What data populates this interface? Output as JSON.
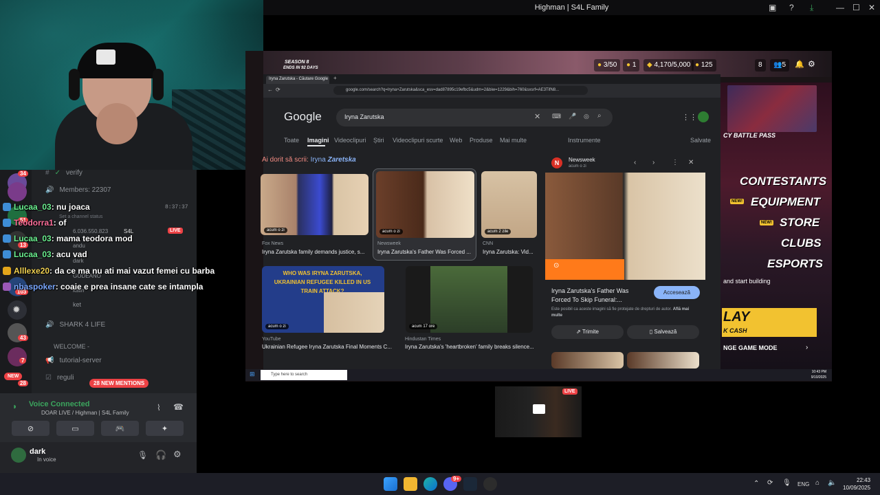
{
  "window": {
    "title": "Highman | S4L Family"
  },
  "discord": {
    "servers": [
      {
        "badge": "34"
      },
      {
        "badge": "51"
      },
      {
        "badge": "13"
      },
      {
        "badge": "103"
      },
      {
        "badge": "43"
      },
      {
        "badge": "7"
      },
      {
        "badge": "NEW"
      },
      {
        "badge": "28"
      }
    ],
    "channels": {
      "verify": "verify",
      "members": "Members: 22307",
      "custom_status": "Set a channel status",
      "count": "6.036.550.823",
      "s4l": "S4L",
      "live": "LIVE",
      "user_andu": "andu",
      "user_dark": "dark",
      "user_gudeano": "GODEANO",
      "user_ket": "ket",
      "user_kalin": "kalin",
      "shark": "SHARK 4 LIFE",
      "welcome": "WELCOME -",
      "tutorial": "tutorial-server",
      "reguli": "reguli",
      "mentions": "28 NEW MENTIONS",
      "time": "8:37:37"
    },
    "chat": [
      {
        "user": "Lucaa_03",
        "text": "nu joaca",
        "color": "green"
      },
      {
        "user": "Teodorra1",
        "text": "of",
        "color": "pink"
      },
      {
        "user": "Lucaa_03",
        "text": "mama teodora mod",
        "color": "green"
      },
      {
        "user": "Lucaa_03",
        "text": "acu vad",
        "color": "green"
      },
      {
        "user": "Alllexe20",
        "text": "da ce ma nu ati mai vazut femei cu barba",
        "color": "yellow"
      },
      {
        "user": "nbaspoker",
        "text": "coaie e prea insane cate se intampla",
        "color": "blue"
      }
    ],
    "voice": {
      "status": "Voice Connected",
      "channel": "DOAR LIVE / Highman | S4L Family"
    },
    "user": {
      "name": "dark",
      "status": "In voice"
    }
  },
  "game": {
    "season": "SEASON 8",
    "season_sub": "ENDS IN 92 DAYS",
    "stat1": "3/50",
    "stat2": "1",
    "stat3": "4,170/5,000",
    "stat4": "125",
    "stat5": "8",
    "stat6": "5",
    "battle_pass": "CY BATTLE PASS",
    "menu": [
      "CONTESTANTS",
      "EQUIPMENT",
      "STORE",
      "CLUBS",
      "ESPORTS"
    ],
    "new_tag": "NEW!",
    "building_text": "and start building",
    "banner_big": "LAY",
    "banner_small": "K CASH",
    "change_mode": "NGE GAME MODE"
  },
  "chrome": {
    "tab_title": "Iryna Zarutska - Căutare Google",
    "url": "google.com/search?q=Iryna+Zarutska&sca_esv=dad87895c19efbc5&udm=2&biw=1229&bih=760&sxsrf=AE3TifN8...",
    "logo": "Google",
    "query": "Iryna Zarutska",
    "tabs": [
      "Toate",
      "Imagini",
      "Videoclipuri",
      "Știri",
      "Videoclipuri scurte",
      "Web",
      "Produse",
      "Mai multe"
    ],
    "tools": "Instrumente",
    "saved": "Salvate",
    "did_you_mean_prefix": "Ai dorit să scrii:",
    "did_you_mean_a": "Iryna",
    "did_you_mean_b": "Zaretska",
    "results": [
      {
        "time": "acum o zi",
        "source": "Fox News",
        "caption": "Iryna Zarutska family demands justice, s..."
      },
      {
        "time": "acum o zi",
        "source": "Newsweek",
        "caption": "Iryna Zarutska's Father Was Forced ..."
      },
      {
        "time": "acum 2 zile",
        "source": "CNN",
        "caption": "Iryna Zarutska: Vid..."
      },
      {
        "time": "acum o zi",
        "source": "YouTube",
        "caption": "Ukrainian Refugee Iryna Zarutska Final Moments C..."
      },
      {
        "time": "acum 17 ore",
        "source": "Hindustan Times",
        "caption": "Iryna Zarutska's 'heartbroken' family breaks silence..."
      }
    ],
    "yt_thumb_text": "WHO WAS IRYNA ZARUTSKA, UKRAINIAN REFUGEE KILLED IN US TRAIN ATTACK?",
    "panel": {
      "source": "Newsweek",
      "time": "acum o zi",
      "title": "Iryna Zarutska's Father Was Forced To Skip Funeral:...",
      "visit": "Accesează",
      "note": "Este posibil ca aceste imagini să fie protejate de drepturi de autor.",
      "note_more": "Află mai multe",
      "share": "Trimite",
      "save": "Salvează"
    }
  },
  "stream_taskbar": {
    "search": "Type here to search",
    "time": "10:43 PM",
    "date": "9/10/2025"
  },
  "mini": {
    "live": "LIVE"
  },
  "taskbar": {
    "lang": "ENG",
    "time": "22:43",
    "date": "10/09/2025",
    "badge": "9+"
  }
}
